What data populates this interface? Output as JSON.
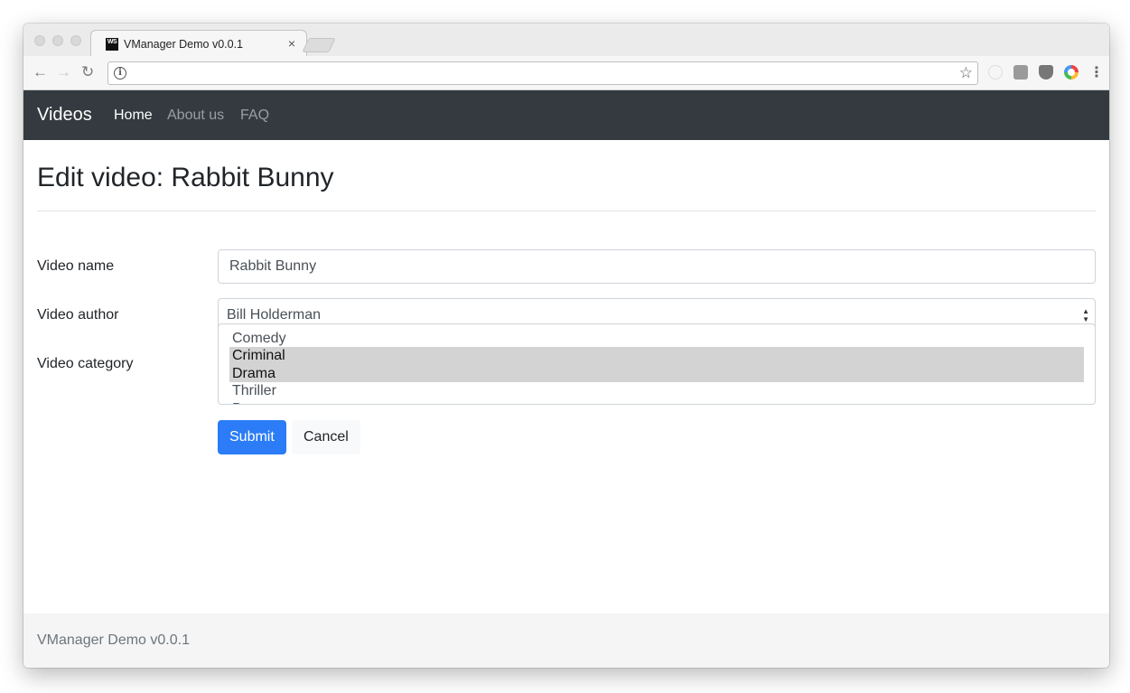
{
  "browser": {
    "tab_title": "VManager Demo v0.0.1",
    "favicon_text": "WS",
    "close_glyph": "×",
    "back_glyph": "←",
    "forward_glyph": "→",
    "reload_glyph": "↻",
    "info_glyph": "i",
    "star_glyph": "☆",
    "menu_glyph": "⋮",
    "address": ""
  },
  "navbar": {
    "brand": "Videos",
    "links": [
      {
        "label": "Home",
        "active": true
      },
      {
        "label": "About us",
        "active": false
      },
      {
        "label": "FAQ",
        "active": false
      }
    ],
    "background": "#343a40"
  },
  "page": {
    "title": "Edit video: Rabbit Bunny"
  },
  "form": {
    "name_label": "Video name",
    "name_value": "Rabbit Bunny",
    "author_label": "Video author",
    "author_value": "Bill Holderman",
    "category_label": "Video category",
    "categories": [
      {
        "label": "Comedy",
        "selected": false
      },
      {
        "label": "Criminal",
        "selected": true
      },
      {
        "label": "Drama",
        "selected": true
      },
      {
        "label": "Thriller",
        "selected": false
      },
      {
        "label": "D",
        "selected": false
      }
    ],
    "submit_label": "Submit",
    "cancel_label": "Cancel",
    "primary_color": "#2b7cf6"
  },
  "footer": {
    "text": "VManager Demo v0.0.1"
  }
}
